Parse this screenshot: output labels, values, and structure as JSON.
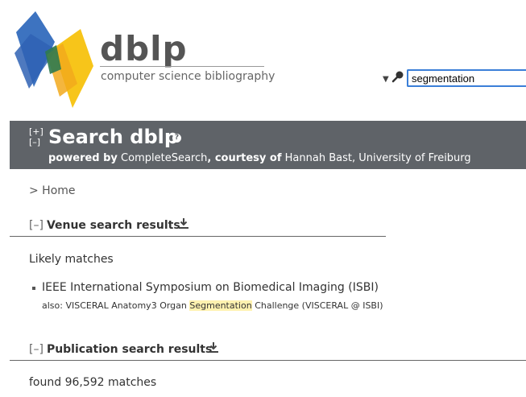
{
  "logo": {
    "word": "dblp",
    "tagline": "computer science bibliography"
  },
  "search": {
    "value": "segmentation"
  },
  "banner": {
    "toggle_expand": "[+]",
    "toggle_collapse": "[–]",
    "title": "Search dblp",
    "help": "?",
    "powered_by": "powered by",
    "engine": "CompleteSearch",
    "courtesy": ", courtesy of",
    "person": "Hannah Bast",
    "affiliation": ", University of Freiburg"
  },
  "breadcrumb": "> Home",
  "venue": {
    "toggle": "[–]",
    "heading": "Venue search results",
    "likely": "Likely matches",
    "item": "IEEE International Symposium on Biomedical Imaging (ISBI)",
    "also_prefix": "also: VISCERAL Anatomy3 Organ",
    "also_highlight": "Segmentation",
    "also_suffix": "Challenge (VISCERAL @ ISBI)"
  },
  "publication": {
    "toggle": "[–]",
    "heading": "Publication search results",
    "found": "found 96,592 matches"
  },
  "colors": {
    "banner": "#5f6368",
    "accent_blue": "#3b7fd8",
    "logo_yellow": "#f7c51a",
    "highlight": "#fff2b0"
  }
}
